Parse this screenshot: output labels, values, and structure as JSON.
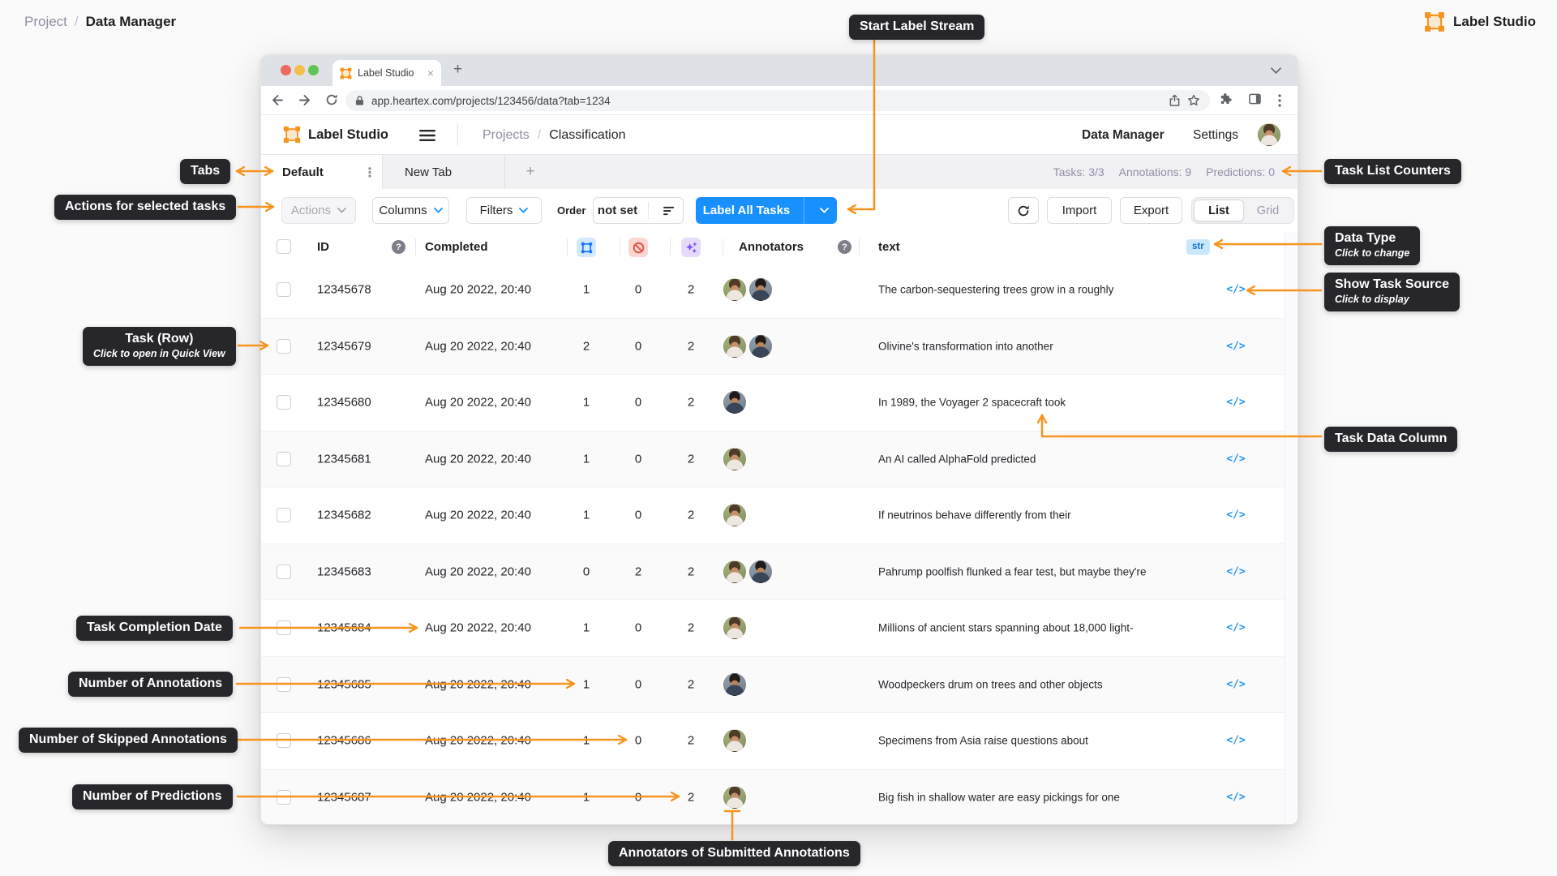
{
  "page": {
    "breadcrumb": {
      "root": "Project",
      "separator": "/",
      "current": "Data Manager"
    },
    "brand": "Label Studio"
  },
  "browser": {
    "tab_title": "Label Studio",
    "tab_close": "×",
    "new_tab": "+",
    "url": "app.heartex.com/projects/123456/data?tab=1234"
  },
  "app": {
    "header": {
      "brand": "Label Studio",
      "breadcrumb_root": "Projects",
      "breadcrumb_sep": "/",
      "breadcrumb_current": "Classification",
      "nav_data_manager": "Data Manager",
      "nav_settings": "Settings"
    },
    "tabs": {
      "active": "Default",
      "kebab": "⋮",
      "inactive": "New Tab",
      "add": "+"
    },
    "counters": {
      "tasks": "Tasks: 3/3",
      "annotations": "Annotations: 9",
      "predictions": "Predictions: 0"
    },
    "toolbar": {
      "actions": "Actions",
      "columns": "Columns",
      "filters": "Filters",
      "order_label": "Order",
      "order_value": "not set",
      "label_all_tasks": "Label All Tasks",
      "import": "Import",
      "export": "Export",
      "view_list": "List",
      "view_grid": "Grid"
    },
    "table": {
      "header": {
        "id": "ID",
        "help": "?",
        "completed": "Completed",
        "annotators": "Annotators",
        "text": "text",
        "data_type": "str"
      },
      "source_icon": "</>",
      "rows": [
        {
          "id": "12345678",
          "completed": "Aug 20 2022, 20:40",
          "annotations": "1",
          "skipped": "0",
          "predictions": "2",
          "annotators": [
            "woman",
            "man"
          ],
          "text": "The carbon-sequestering trees grow in a roughly"
        },
        {
          "id": "12345679",
          "completed": "Aug 20 2022, 20:40",
          "annotations": "2",
          "skipped": "0",
          "predictions": "2",
          "annotators": [
            "woman",
            "man"
          ],
          "text": "Olivine's transformation into another"
        },
        {
          "id": "12345680",
          "completed": "Aug 20 2022, 20:40",
          "annotations": "1",
          "skipped": "0",
          "predictions": "2",
          "annotators": [
            "man"
          ],
          "text": "In 1989, the Voyager 2 spacecraft took"
        },
        {
          "id": "12345681",
          "completed": "Aug 20 2022, 20:40",
          "annotations": "1",
          "skipped": "0",
          "predictions": "2",
          "annotators": [
            "woman"
          ],
          "text": "An AI called AlphaFold predicted"
        },
        {
          "id": "12345682",
          "completed": "Aug 20 2022, 20:40",
          "annotations": "1",
          "skipped": "0",
          "predictions": "2",
          "annotators": [
            "woman"
          ],
          "text": "If neutrinos behave differently from their"
        },
        {
          "id": "12345683",
          "completed": "Aug 20 2022, 20:40",
          "annotations": "0",
          "skipped": "2",
          "predictions": "2",
          "annotators": [
            "woman",
            "man"
          ],
          "text": "Pahrump poolfish flunked a fear test, but maybe they're"
        },
        {
          "id": "12345684",
          "completed": "Aug 20 2022, 20:40",
          "annotations": "1",
          "skipped": "0",
          "predictions": "2",
          "annotators": [
            "woman"
          ],
          "text": "Millions of ancient stars spanning about 18,000 light-"
        },
        {
          "id": "12345685",
          "completed": "Aug 20 2022, 20:40",
          "annotations": "1",
          "skipped": "0",
          "predictions": "2",
          "annotators": [
            "man"
          ],
          "text": "Woodpeckers drum on trees and other objects"
        },
        {
          "id": "12345686",
          "completed": "Aug 20 2022, 20:40",
          "annotations": "1",
          "skipped": "0",
          "predictions": "2",
          "annotators": [
            "woman"
          ],
          "text": "Specimens from Asia raise questions about"
        },
        {
          "id": "12345687",
          "completed": "Aug 20 2022, 20:40",
          "annotations": "1",
          "skipped": "0",
          "predictions": "2",
          "annotators": [
            "woman"
          ],
          "text": "Big fish in shallow water are easy pickings for one"
        }
      ]
    }
  },
  "callouts": {
    "start_label_stream": "Start Label Stream",
    "tabs": "Tabs",
    "actions_for_selected_tasks": "Actions for selected tasks",
    "task_row": "Task (Row)",
    "task_row_sub": "Click to open in Quick View",
    "task_completion_date": "Task Completion Date",
    "number_of_annotations": "Number of Annotations",
    "number_of_skipped_annotations": "Number of Skipped Annotations",
    "number_of_predictions": "Number of Predictions",
    "task_list_counters": "Task List Counters",
    "data_type": "Data Type",
    "data_type_sub": "Click to change",
    "show_task_source": "Show Task Source",
    "show_task_source_sub": "Click to display",
    "task_data_column": "Task Data Column",
    "annotators_of_submitted": "Annotators of Submitted Annotations"
  },
  "colors": {
    "accent_orange": "#F7941E",
    "primary_blue": "#1890FF",
    "callout_bg": "#26262B",
    "skip_red": "#E5483C",
    "predictions_purple": "#7C4DFF"
  }
}
